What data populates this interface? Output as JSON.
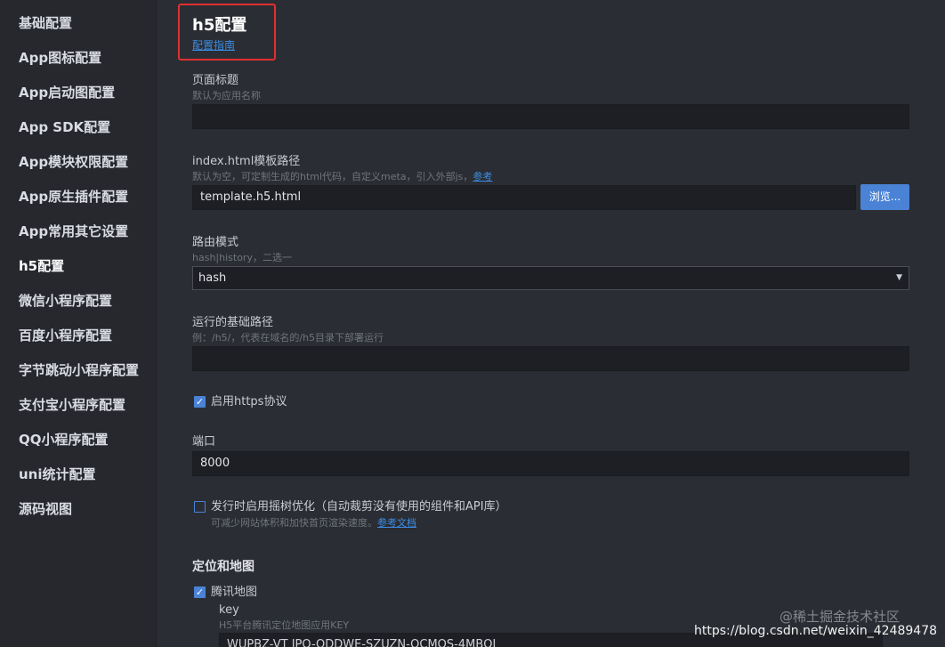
{
  "sidebar": {
    "items": [
      {
        "label": "基础配置"
      },
      {
        "label": "App图标配置"
      },
      {
        "label": "App启动图配置"
      },
      {
        "label": "App SDK配置"
      },
      {
        "label": "App模块权限配置"
      },
      {
        "label": "App原生插件配置"
      },
      {
        "label": "App常用其它设置"
      },
      {
        "label": "h5配置"
      },
      {
        "label": "微信小程序配置"
      },
      {
        "label": "百度小程序配置"
      },
      {
        "label": "字节跳动小程序配置"
      },
      {
        "label": "支付宝小程序配置"
      },
      {
        "label": "QQ小程序配置"
      },
      {
        "label": "uni统计配置"
      },
      {
        "label": "源码视图"
      }
    ],
    "active_index": 7
  },
  "page": {
    "title": "h5配置",
    "guide_link": "配置指南",
    "highlight_color": "#e0302e"
  },
  "fields": {
    "page_title": {
      "label": "页面标题",
      "hint": "默认为应用名称",
      "value": ""
    },
    "template": {
      "label": "index.html模板路径",
      "hint": "默认为空，可定制生成的html代码，自定义meta，引入外部js，",
      "hint_link": "参考",
      "value": "template.h5.html",
      "browse_label": "浏览..."
    },
    "router_mode": {
      "label": "路由模式",
      "hint": "hash|history，二选一",
      "selected": "hash"
    },
    "base_path": {
      "label": "运行的基础路径",
      "hint": "例：/h5/，代表在域名的/h5目录下部署运行",
      "value": ""
    },
    "https": {
      "label": "启用https协议",
      "checked": true
    },
    "port": {
      "label": "端口",
      "value": "8000"
    },
    "treeshake": {
      "label": "发行时启用摇树优化（自动裁剪没有使用的组件和API库）",
      "hint": "可减少网站体积和加快首页渲染速度。",
      "hint_link": "参考文档",
      "checked": false
    }
  },
  "map_section": {
    "title": "定位和地图",
    "tencent_map": {
      "label": "腾讯地图",
      "checked": true
    },
    "key": {
      "label": "key",
      "hint": "H5平台腾讯定位地图应用KEY",
      "value": "WUPBZ-VT  JPO-ODDWE-SZUZN-OCMQS-4MBQJ"
    }
  },
  "watermarks": {
    "juejin": "@稀土掘金技术社区",
    "csdn": "https://blog.csdn.net/weixin_42489478"
  },
  "colors": {
    "accent": "#4a83d6",
    "link": "#3a8ee6"
  }
}
